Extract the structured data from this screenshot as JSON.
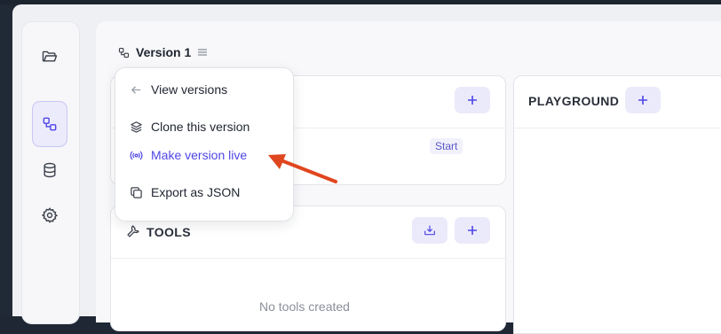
{
  "version": {
    "label": "Version 1"
  },
  "menu": {
    "items": [
      {
        "label": "View versions",
        "icon": "arrow-left-icon"
      },
      {
        "label": "Clone this version",
        "icon": "layers-icon"
      },
      {
        "label": "Make version live",
        "icon": "broadcast-icon",
        "accent": "#4f46e5"
      },
      {
        "label": "Export as JSON",
        "icon": "copy-icon"
      }
    ]
  },
  "playground": {
    "title": "PLAYGROUND"
  },
  "flow": {
    "badge": "Start"
  },
  "tools": {
    "title": "TOOLS",
    "empty": "No tools created"
  },
  "colors": {
    "accent": "#4f46e5",
    "annotation_arrow": "#e0461f"
  }
}
